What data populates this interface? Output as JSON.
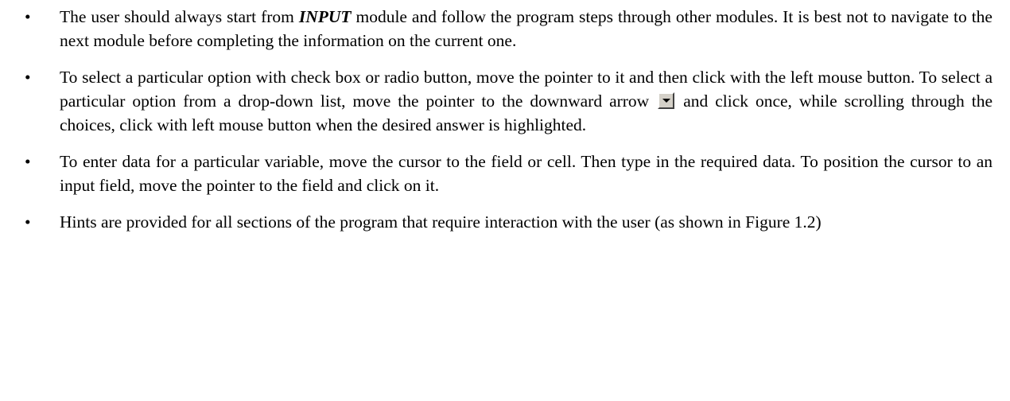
{
  "bullets": [
    {
      "before": "The user should always start from ",
      "emphasis": "INPUT",
      "after": " module and follow the program steps through other modules.  It is best not to navigate to the next module before completing the information on the current one."
    },
    {
      "before": "To select a particular option with check box or radio button, move the pointer to it and then click with the left mouse button.  To select a particular option from a drop-down list, move the pointer to the downward arrow",
      "icon": "dropdown-arrow-icon",
      "after": "and click once, while scrolling through the choices, click with left mouse button when the desired answer is highlighted."
    },
    {
      "text": "To enter data for a particular variable, move the cursor to the field or cell. Then type in the required data. To position the cursor to an input field, move the pointer to the field and click on it."
    },
    {
      "text": "Hints are provided for all sections of the program that require interaction with the user (as shown in Figure 1.2)"
    }
  ],
  "bullet_symbol": "•"
}
